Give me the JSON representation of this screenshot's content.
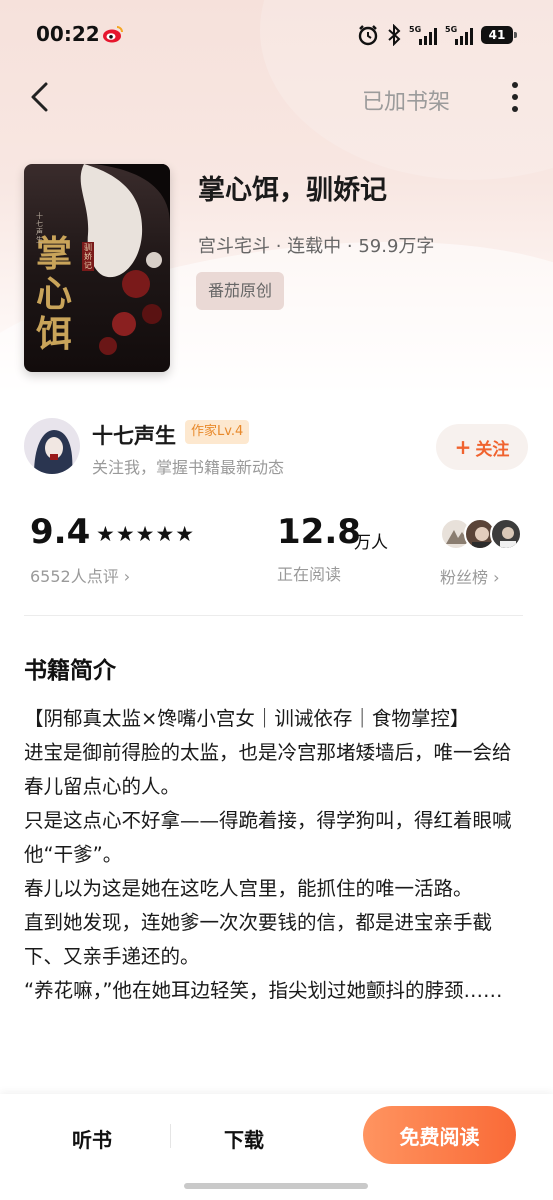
{
  "status_bar": {
    "time": "00:22",
    "battery": "41",
    "network": [
      "5G",
      "5G"
    ]
  },
  "nav": {
    "shelf_label": "已加书架"
  },
  "book": {
    "title": "掌心饵，驯娇记",
    "meta": "宫斗宅斗 · 连载中 · 59.9万字",
    "tag": "番茄原创",
    "cover_title": "掌心饵",
    "cover_subtitle": "驯娇记",
    "cover_author": "十七声生"
  },
  "author": {
    "name": "十七声生",
    "level": "作家Lv.4",
    "desc": "关注我，掌握书籍最新动态",
    "follow_label": "关注"
  },
  "stats": {
    "score": "9.4",
    "stars": "★★★★★",
    "reviews": "6552人点评 ›",
    "readers": "12.8",
    "readers_unit": "万人",
    "readers_label": "正在阅读",
    "fans_label": "粉丝榜 ›"
  },
  "intro": {
    "title": "书籍简介",
    "paragraphs": [
      "【阴郁真太监×馋嘴小宫女｜训诫依存｜食物掌控】",
      "进宝是御前得脸的太监，也是冷宫那堵矮墙后，唯一会给春儿留点心的人。",
      "只是这点心不好拿——得跪着接，得学狗叫，得红着眼喊他“干爹”。",
      "春儿以为这是她在这吃人宫里，能抓住的唯一活路。",
      "直到她发现，连她爹一次次要钱的信，都是进宝亲手截下、又亲手递还的。",
      "“养花嘛，”他在她耳边轻笑，指尖划过她颤抖的脖颈……"
    ]
  },
  "bottom": {
    "listen": "听书",
    "download": "下载",
    "read": "免费阅读"
  },
  "colors": {
    "accent": "#f96a37",
    "level_badge": "#e8892b",
    "tag_bg": "#ead9d5"
  }
}
